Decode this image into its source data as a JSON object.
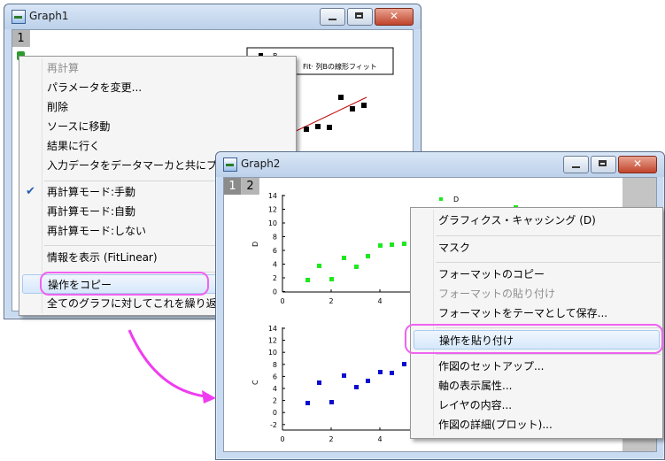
{
  "graph1": {
    "title": "Graph1",
    "layer_tab": "1",
    "legend": [
      "B",
      "Fit· 列Bの線形フィット"
    ],
    "menu": [
      "再計算",
      "パラメータを変更...",
      "削除",
      "ソースに移動",
      "結果に行く",
      "入力データをデータマーカと共にプ",
      "再計算モード:手動",
      "再計算モード:自動",
      "再計算モード:しない",
      "情報を表示 (FitLinear)",
      "操作をコピー",
      "全てのグラフに対してこれを繰り返"
    ],
    "checked_item": "再計算モード:手動"
  },
  "graph2": {
    "title": "Graph2",
    "layer_tabs": [
      "1",
      "2"
    ],
    "legend": [
      "D"
    ],
    "menu": [
      "グラフィクス・キャッシング (D)",
      "マスク",
      "フォーマットのコピー",
      "フォーマットの貼り付け",
      "フォーマットをテーマとして保存...",
      "操作を貼り付け",
      "作図のセットアップ...",
      "軸の表示属性...",
      "レイヤの内容...",
      "作図の詳細(プロット)..."
    ],
    "top_plot": {
      "ylabel": "D",
      "yticks": [
        "14",
        "12",
        "10",
        "8",
        "6",
        "4",
        "2",
        "0"
      ],
      "xticks": [
        "0",
        "2",
        "4"
      ]
    },
    "bottom_plot": {
      "ylabel": "C",
      "yticks": [
        "14",
        "12",
        "10",
        "8",
        "6",
        "4",
        "2",
        "0",
        "-2"
      ],
      "xticks": [
        "0",
        "2",
        "4"
      ]
    }
  },
  "colors": {
    "green_series": "#1ee81e",
    "blue_series": "#0a0ad0",
    "highlight": "#f062f0",
    "arrow": "#f03cf0"
  }
}
